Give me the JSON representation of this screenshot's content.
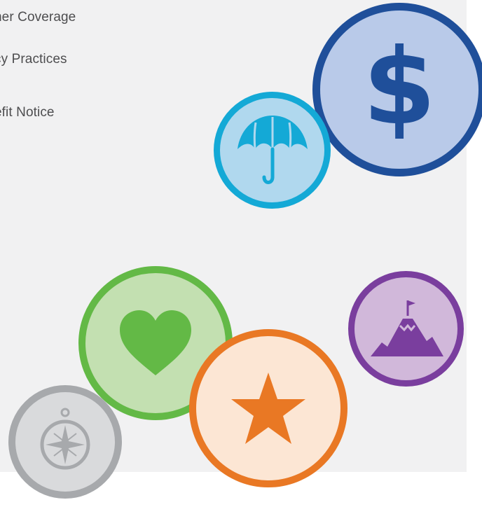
{
  "links": [
    {
      "label": "ner Coverage"
    },
    {
      "label": "cy Practices"
    },
    {
      "label": "efit Notice"
    }
  ],
  "icons": {
    "dollar": {
      "glyph": "$",
      "ring": "#1f4f9a",
      "fill": "#b9cae9"
    },
    "umbrella": {
      "ring": "#14a9d6",
      "fill": "#b0d8ee"
    },
    "heart": {
      "ring": "#63b946",
      "fill": "#c3e0b1"
    },
    "star": {
      "ring": "#e97824",
      "fill": "#fce6d4"
    },
    "mountain": {
      "ring": "#7a3e9e",
      "fill": "#d1b8da"
    },
    "compass": {
      "ring": "#a7a9ac",
      "fill": "#d9dadc"
    }
  }
}
